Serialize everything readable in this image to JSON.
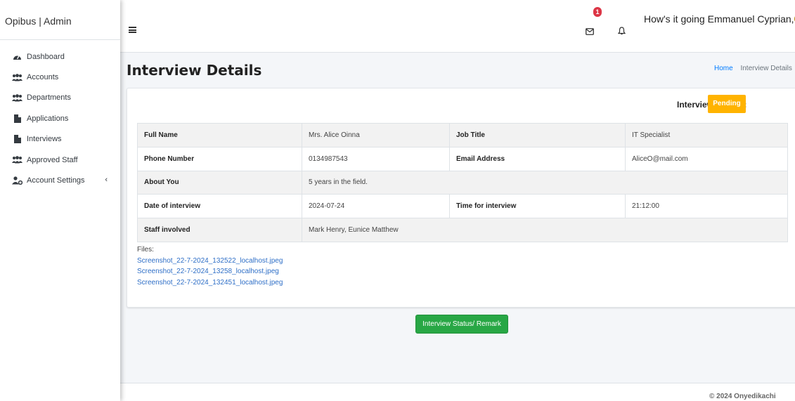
{
  "brand": "Opibus | Admin",
  "sidebar": {
    "items": [
      {
        "label": "Dashboard",
        "icon": "dashboard-icon"
      },
      {
        "label": "Accounts",
        "icon": "users-icon"
      },
      {
        "label": "Departments",
        "icon": "users-icon"
      },
      {
        "label": "Applications",
        "icon": "file-icon"
      },
      {
        "label": "Interviews",
        "icon": "file-icon"
      },
      {
        "label": "Approved Staff",
        "icon": "users-icon"
      },
      {
        "label": "Account Settings",
        "icon": "user-cog-icon",
        "caret": "‹"
      }
    ]
  },
  "topbar": {
    "mail_badge": "1",
    "greeting": "How's it going Emmanuel Cyprian,"
  },
  "page": {
    "title": "Interview Details",
    "breadcrumb": {
      "home": "Home",
      "current": "Interview Details"
    }
  },
  "status": {
    "label": "Interview Status :",
    "value": "Pending",
    "color": "#ffb300"
  },
  "details": [
    [
      "Full Name",
      "Mrs. Alice Oinna",
      "Job Title",
      "IT Specialist"
    ],
    [
      "Phone Number",
      "0134987543",
      "Email Address",
      "AliceO@mail.com"
    ],
    [
      "About You",
      "5 years in the field."
    ],
    [
      "Date of interview",
      "2024-07-24",
      "Time for interview",
      "21:12:00"
    ],
    [
      "Staff involved",
      "Mark Henry, Eunice Matthew"
    ]
  ],
  "files": {
    "label": "Files:",
    "items": [
      "Screenshot_22-7-2024_132522_localhost.jpeg",
      "Screenshot_22-7-2024_13258_localhost.jpeg",
      "Screenshot_22-7-2024_132451_localhost.jpeg"
    ]
  },
  "action_button": "Interview Status/ Remark",
  "footer": "© 2024 Onyedikachi",
  "colors": {
    "accent": "#28a745",
    "link": "#007bff",
    "badge": "#dc3545"
  }
}
